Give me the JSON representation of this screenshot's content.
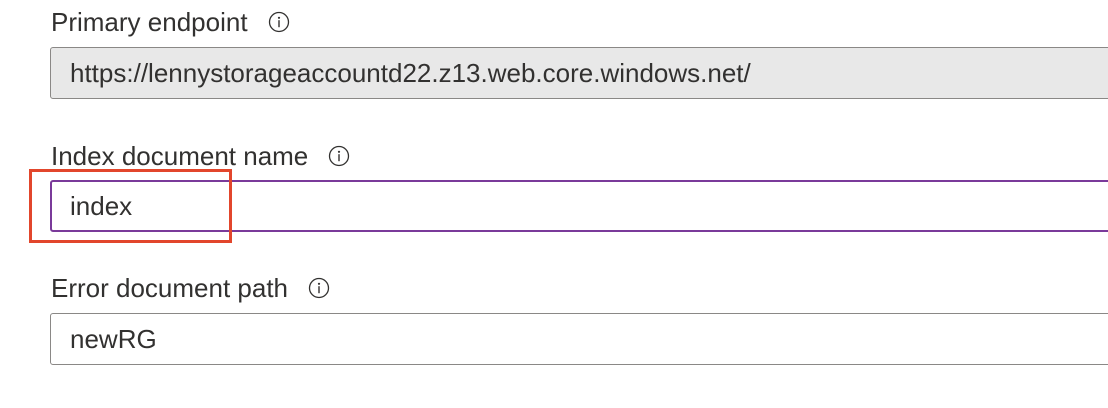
{
  "fields": {
    "primary_endpoint": {
      "label": "Primary endpoint",
      "value": "https://lennystorageaccountd22.z13.web.core.windows.net/"
    },
    "index_document": {
      "label": "Index document name",
      "value": "index"
    },
    "error_document": {
      "label": "Error document path",
      "value": "newRG"
    }
  },
  "colors": {
    "focus_border": "#7a3a9a",
    "highlight": "#e2462c",
    "readonly_bg": "#e8e8e8"
  },
  "icons": {
    "info": "info-icon"
  }
}
